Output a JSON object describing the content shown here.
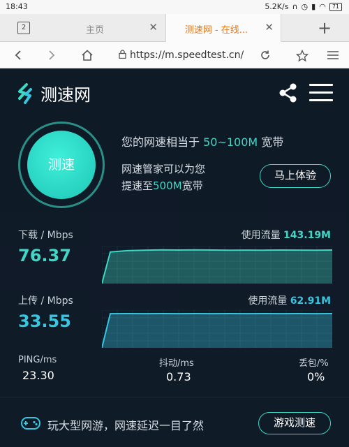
{
  "status_bar": {
    "time": "18:43",
    "right_text": "5.2K/s",
    "battery": "71"
  },
  "tabs": {
    "count": "2",
    "items": [
      {
        "title": "主页"
      },
      {
        "title": "测速网 - 在线..."
      }
    ],
    "new_tab": "+"
  },
  "address_bar": {
    "url": "https://m.speedtest.cn/"
  },
  "header": {
    "app_name": "测速网"
  },
  "test": {
    "button_label": "测速"
  },
  "equivalence": {
    "prefix": "您的网速相当于 ",
    "range": "50~100M",
    "suffix": " 宽带"
  },
  "upgrade": {
    "line1": "网速管家可以为您",
    "line2_prefix": "提速至",
    "line2_value": "500M",
    "line2_suffix": "宽带",
    "button_label": "马上体验"
  },
  "download": {
    "label": "下载 / Mbps",
    "value": "76.37",
    "traffic_label": "使用流量 ",
    "traffic_value": "143.19M"
  },
  "upload": {
    "label": "上传 / Mbps",
    "value": "33.55",
    "traffic_label": "使用流量 ",
    "traffic_value": "62.91M"
  },
  "stats": {
    "ping": {
      "label": "PING/ms",
      "value": "23.30"
    },
    "jitter": {
      "label": "抖动/ms",
      "value": "0.73"
    },
    "loss": {
      "label": "丢包/%",
      "value": "0%"
    }
  },
  "game": {
    "text": "玩大型网游，网速延迟一目了然",
    "button_label": "游戏测速"
  },
  "colors": {
    "accent_green": "#3fd7c6",
    "accent_cyan": "#37c6e0",
    "background": "#0f1a26",
    "tab_active_text": "#e07a1f"
  },
  "chart_data": [
    {
      "type": "area",
      "series": [
        {
          "name": "下载",
          "values": [
            0,
            72,
            75,
            76,
            77,
            76.5,
            77,
            76.5,
            76,
            76.3,
            76.2,
            76.4,
            76.3,
            76.2,
            76.4
          ]
        }
      ]
    },
    {
      "type": "area",
      "series": [
        {
          "name": "上传",
          "values": [
            0,
            33.5,
            33.6,
            33.5,
            33.6,
            33.5,
            33.6,
            33.5,
            33.6,
            33.5,
            33.6,
            33.5,
            33.6,
            33.5,
            33.55
          ]
        }
      ]
    }
  ]
}
